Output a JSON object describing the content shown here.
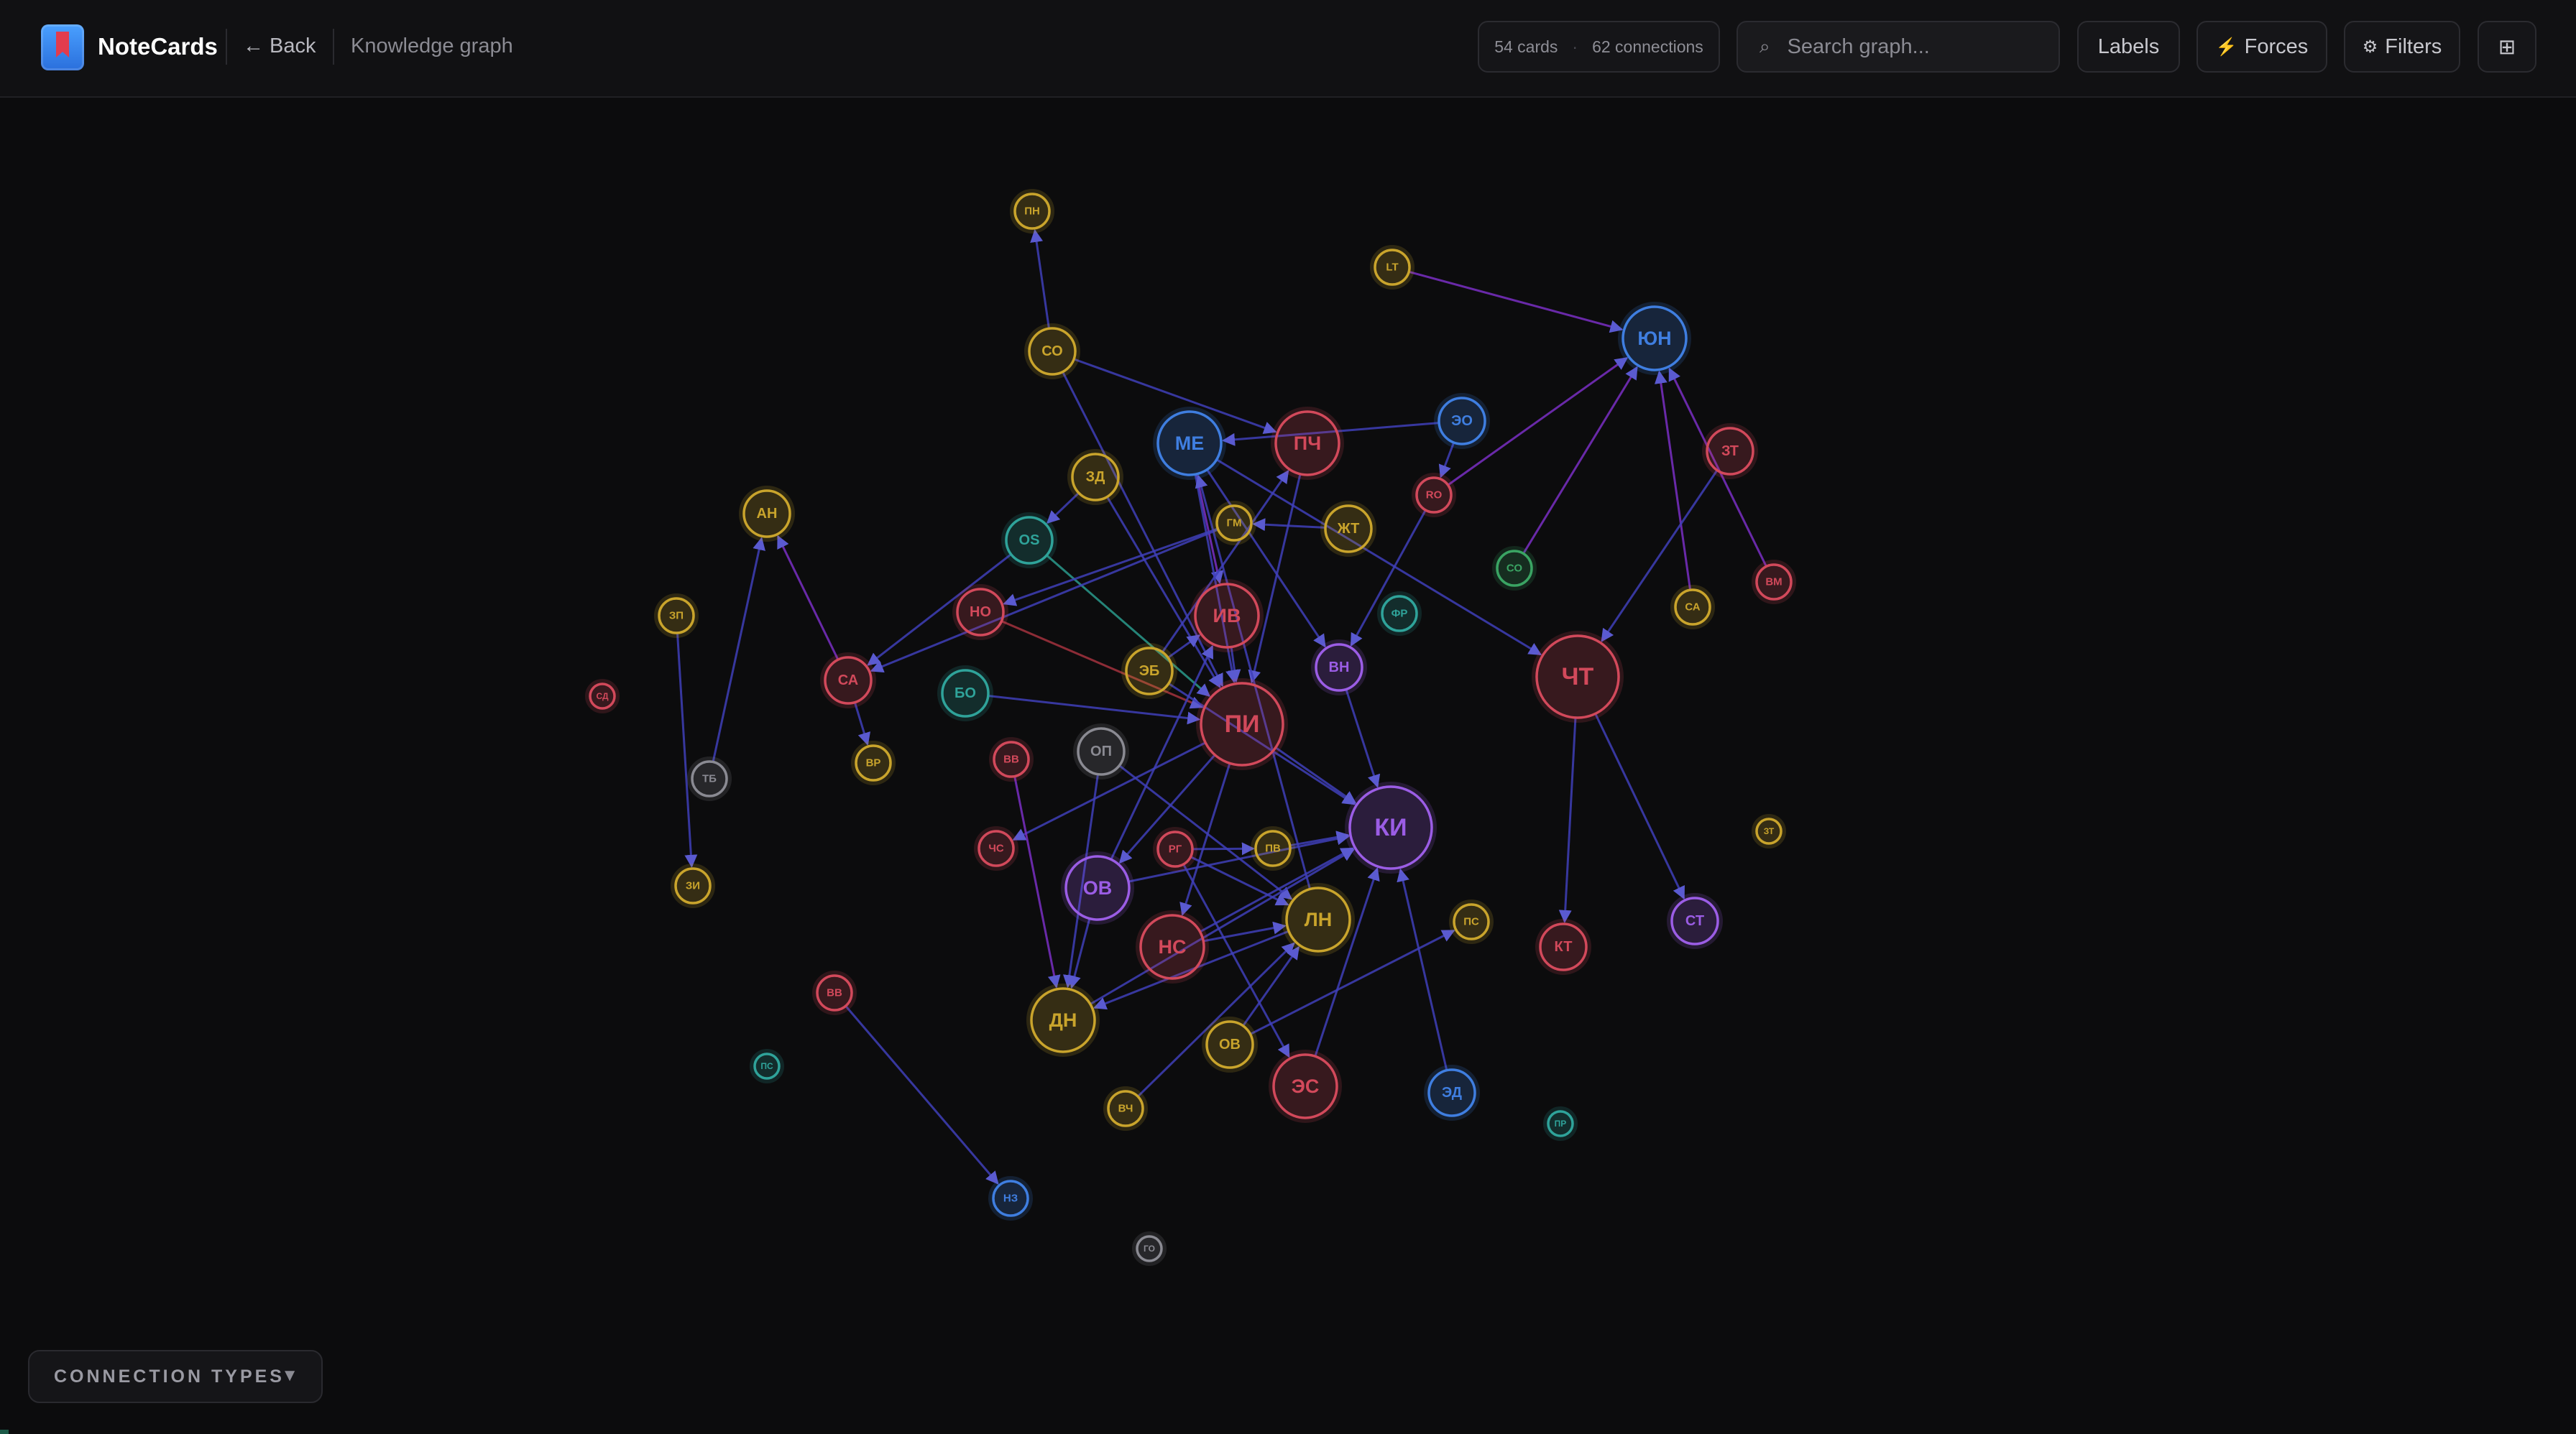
{
  "header": {
    "app_name": "NoteCards",
    "back_label": "← Back",
    "breadcrumb": "Knowledge graph",
    "stats": {
      "cards": "54 cards",
      "connections": "62 connections"
    },
    "search_placeholder": "Search graph...",
    "search_icon": "⌕",
    "labels_button": "Labels",
    "forces_button": "Forces",
    "forces_icon": "⚡",
    "filters_button": "Filters",
    "filters_icon": "⚙",
    "grid_icon": "⊞"
  },
  "footer": {
    "connection_types_label": "CONNECTION TYPES",
    "connection_types_chevron": "▼"
  },
  "colors": {
    "gold": "#c9a42c",
    "red": "#d2495b",
    "blue": "#3f7ee0",
    "purple": "#9b5de5",
    "teal": "#2fa39a",
    "gray": "#8a8a92",
    "green": "#3aa463",
    "edge_default": "#4040b8",
    "edge_purple": "#7a2fc4",
    "edge_red": "#a3323e",
    "edge_teal": "#2a9a8c"
  },
  "graph": {
    "nodes": [
      {
        "id": "n1",
        "label": "ПН",
        "color": "gold",
        "size": "s"
      },
      {
        "id": "n2",
        "label": "LT",
        "color": "gold",
        "size": "s"
      },
      {
        "id": "n3",
        "label": "ЮН",
        "color": "blue",
        "size": "l"
      },
      {
        "id": "n4",
        "label": "СО",
        "color": "gold",
        "size": "m"
      },
      {
        "id": "n5",
        "label": "ПЧ",
        "color": "red",
        "size": "l"
      },
      {
        "id": "n6",
        "label": "МЕ",
        "color": "blue",
        "size": "l"
      },
      {
        "id": "n7",
        "label": "ЭО",
        "color": "blue",
        "size": "m"
      },
      {
        "id": "n8",
        "label": "ЗТ",
        "color": "red",
        "size": "m"
      },
      {
        "id": "n9",
        "label": "ЗД",
        "color": "gold",
        "size": "m"
      },
      {
        "id": "n10",
        "label": "RO",
        "color": "red",
        "size": "s"
      },
      {
        "id": "n11",
        "label": "АН",
        "color": "gold",
        "size": "m"
      },
      {
        "id": "n12",
        "label": "OS",
        "color": "teal",
        "size": "m"
      },
      {
        "id": "n13",
        "label": "ГМ",
        "color": "gold",
        "size": "s"
      },
      {
        "id": "n14",
        "label": "ЖТ",
        "color": "gold",
        "size": "m"
      },
      {
        "id": "n15",
        "label": "СО",
        "color": "green",
        "size": "s"
      },
      {
        "id": "n16",
        "label": "ВМ",
        "color": "red",
        "size": "s"
      },
      {
        "id": "n17",
        "label": "ЗП",
        "color": "gold",
        "size": "s"
      },
      {
        "id": "n18",
        "label": "НО",
        "color": "red",
        "size": "m"
      },
      {
        "id": "n19",
        "label": "ИВ",
        "color": "red",
        "size": "l"
      },
      {
        "id": "n20",
        "label": "ФР",
        "color": "teal",
        "size": "s"
      },
      {
        "id": "n21",
        "label": "СА",
        "color": "gold",
        "size": "s"
      },
      {
        "id": "n22",
        "label": "СД",
        "color": "red",
        "size": "xs"
      },
      {
        "id": "n23",
        "label": "СА",
        "color": "red",
        "size": "m"
      },
      {
        "id": "n24",
        "label": "ЭБ",
        "color": "gold",
        "size": "m"
      },
      {
        "id": "n25",
        "label": "БО",
        "color": "teal",
        "size": "m"
      },
      {
        "id": "n26",
        "label": "ВН",
        "color": "purple",
        "size": "m"
      },
      {
        "id": "n27",
        "label": "ЧТ",
        "color": "red",
        "size": "xl"
      },
      {
        "id": "n28",
        "label": "ПИ",
        "color": "red",
        "size": "xl"
      },
      {
        "id": "n29",
        "label": "ТБ",
        "color": "gray",
        "size": "s"
      },
      {
        "id": "n30",
        "label": "ВР",
        "color": "gold",
        "size": "s"
      },
      {
        "id": "n31",
        "label": "ВВ",
        "color": "red",
        "size": "s"
      },
      {
        "id": "n32",
        "label": "ОП",
        "color": "gray",
        "size": "m"
      },
      {
        "id": "n33",
        "label": "КИ",
        "color": "purple",
        "size": "xl"
      },
      {
        "id": "n34",
        "label": "ЗТ",
        "color": "gold",
        "size": "xs"
      },
      {
        "id": "n35",
        "label": "ЧС",
        "color": "red",
        "size": "s"
      },
      {
        "id": "n36",
        "label": "РГ",
        "color": "red",
        "size": "s"
      },
      {
        "id": "n37",
        "label": "ПВ",
        "color": "gold",
        "size": "s"
      },
      {
        "id": "n38",
        "label": "ЗИ",
        "color": "gold",
        "size": "s"
      },
      {
        "id": "n39",
        "label": "ОВ",
        "color": "purple",
        "size": "l"
      },
      {
        "id": "n40",
        "label": "ЛН",
        "color": "gold",
        "size": "l"
      },
      {
        "id": "n41",
        "label": "ПС",
        "color": "gold",
        "size": "s"
      },
      {
        "id": "n42",
        "label": "СТ",
        "color": "purple",
        "size": "m"
      },
      {
        "id": "n43",
        "label": "КТ",
        "color": "red",
        "size": "m"
      },
      {
        "id": "n44",
        "label": "НС",
        "color": "red",
        "size": "l"
      },
      {
        "id": "n45",
        "label": "ВВ",
        "color": "red",
        "size": "s"
      },
      {
        "id": "n46",
        "label": "ДН",
        "color": "gold",
        "size": "l"
      },
      {
        "id": "n47",
        "label": "ОВ",
        "color": "gold",
        "size": "m"
      },
      {
        "id": "n48",
        "label": "ПС",
        "color": "teal",
        "size": "xs"
      },
      {
        "id": "n49",
        "label": "ЭС",
        "color": "red",
        "size": "l"
      },
      {
        "id": "n50",
        "label": "ЭД",
        "color": "blue",
        "size": "m"
      },
      {
        "id": "n51",
        "label": "ВЧ",
        "color": "gold",
        "size": "s"
      },
      {
        "id": "n52",
        "label": "ПР",
        "color": "teal",
        "size": "xs"
      },
      {
        "id": "n53",
        "label": "НЗ",
        "color": "blue",
        "size": "s"
      },
      {
        "id": "n54",
        "label": "ГО",
        "color": "gray",
        "size": "xs"
      }
    ],
    "edges": [
      [
        "n4",
        "n1",
        "edge_default"
      ],
      [
        "n2",
        "n3",
        "edge_purple"
      ],
      [
        "n4",
        "n5",
        "edge_default"
      ],
      [
        "n4",
        "n28",
        "edge_default"
      ],
      [
        "n7",
        "n6",
        "edge_default"
      ],
      [
        "n10",
        "n3",
        "edge_purple"
      ],
      [
        "n15",
        "n3",
        "edge_purple"
      ],
      [
        "n21",
        "n3",
        "edge_purple"
      ],
      [
        "n16",
        "n3",
        "edge_purple"
      ],
      [
        "n8",
        "n27",
        "edge_default"
      ],
      [
        "n27",
        "n42",
        "edge_default"
      ],
      [
        "n27",
        "n43",
        "edge_default"
      ],
      [
        "n6",
        "n27",
        "edge_default"
      ],
      [
        "n7",
        "n10",
        "edge_default"
      ],
      [
        "n10",
        "n26",
        "edge_default"
      ],
      [
        "n6",
        "n19",
        "edge_purple"
      ],
      [
        "n6",
        "n26",
        "edge_default"
      ],
      [
        "n6",
        "n28",
        "edge_default"
      ],
      [
        "n5",
        "n28",
        "edge_default"
      ],
      [
        "n9",
        "n12",
        "edge_default"
      ],
      [
        "n9",
        "n28",
        "edge_default"
      ],
      [
        "n12",
        "n28",
        "edge_teal"
      ],
      [
        "n12",
        "n23",
        "edge_default"
      ],
      [
        "n13",
        "n23",
        "edge_default"
      ],
      [
        "n14",
        "n13",
        "edge_default"
      ],
      [
        "n13",
        "n18",
        "edge_default"
      ],
      [
        "n18",
        "n28",
        "edge_red"
      ],
      [
        "n23",
        "n11",
        "edge_purple"
      ],
      [
        "n23",
        "n30",
        "edge_default"
      ],
      [
        "n29",
        "n11",
        "edge_default"
      ],
      [
        "n17",
        "n38",
        "edge_default"
      ],
      [
        "n19",
        "n28",
        "edge_default"
      ],
      [
        "n24",
        "n19",
        "edge_default"
      ],
      [
        "n24",
        "n5",
        "edge_default"
      ],
      [
        "n25",
        "n28",
        "edge_default"
      ],
      [
        "n28",
        "n33",
        "edge_default"
      ],
      [
        "n28",
        "n35",
        "edge_default"
      ],
      [
        "n28",
        "n39",
        "edge_default"
      ],
      [
        "n28",
        "n44",
        "edge_default"
      ],
      [
        "n32",
        "n46",
        "edge_default"
      ],
      [
        "n32",
        "n40",
        "edge_default"
      ],
      [
        "n31",
        "n46",
        "edge_purple"
      ],
      [
        "n39",
        "n33",
        "edge_default"
      ],
      [
        "n39",
        "n19",
        "edge_default"
      ],
      [
        "n36",
        "n37",
        "edge_default"
      ],
      [
        "n37",
        "n33",
        "edge_default"
      ],
      [
        "n36",
        "n49",
        "edge_default"
      ],
      [
        "n44",
        "n33",
        "edge_default"
      ],
      [
        "n40",
        "n46",
        "edge_default"
      ],
      [
        "n46",
        "n33",
        "edge_default"
      ],
      [
        "n51",
        "n40",
        "edge_default"
      ],
      [
        "n47",
        "n40",
        "edge_default"
      ],
      [
        "n47",
        "n41",
        "edge_default"
      ],
      [
        "n49",
        "n33",
        "edge_default"
      ],
      [
        "n50",
        "n33",
        "edge_default"
      ],
      [
        "n45",
        "n53",
        "edge_default"
      ],
      [
        "n40",
        "n6",
        "edge_default"
      ],
      [
        "n39",
        "n46",
        "edge_default"
      ],
      [
        "n26",
        "n33",
        "edge_default"
      ],
      [
        "n24",
        "n33",
        "edge_default"
      ],
      [
        "n44",
        "n40",
        "edge_default"
      ],
      [
        "n36",
        "n40",
        "edge_default"
      ]
    ]
  }
}
